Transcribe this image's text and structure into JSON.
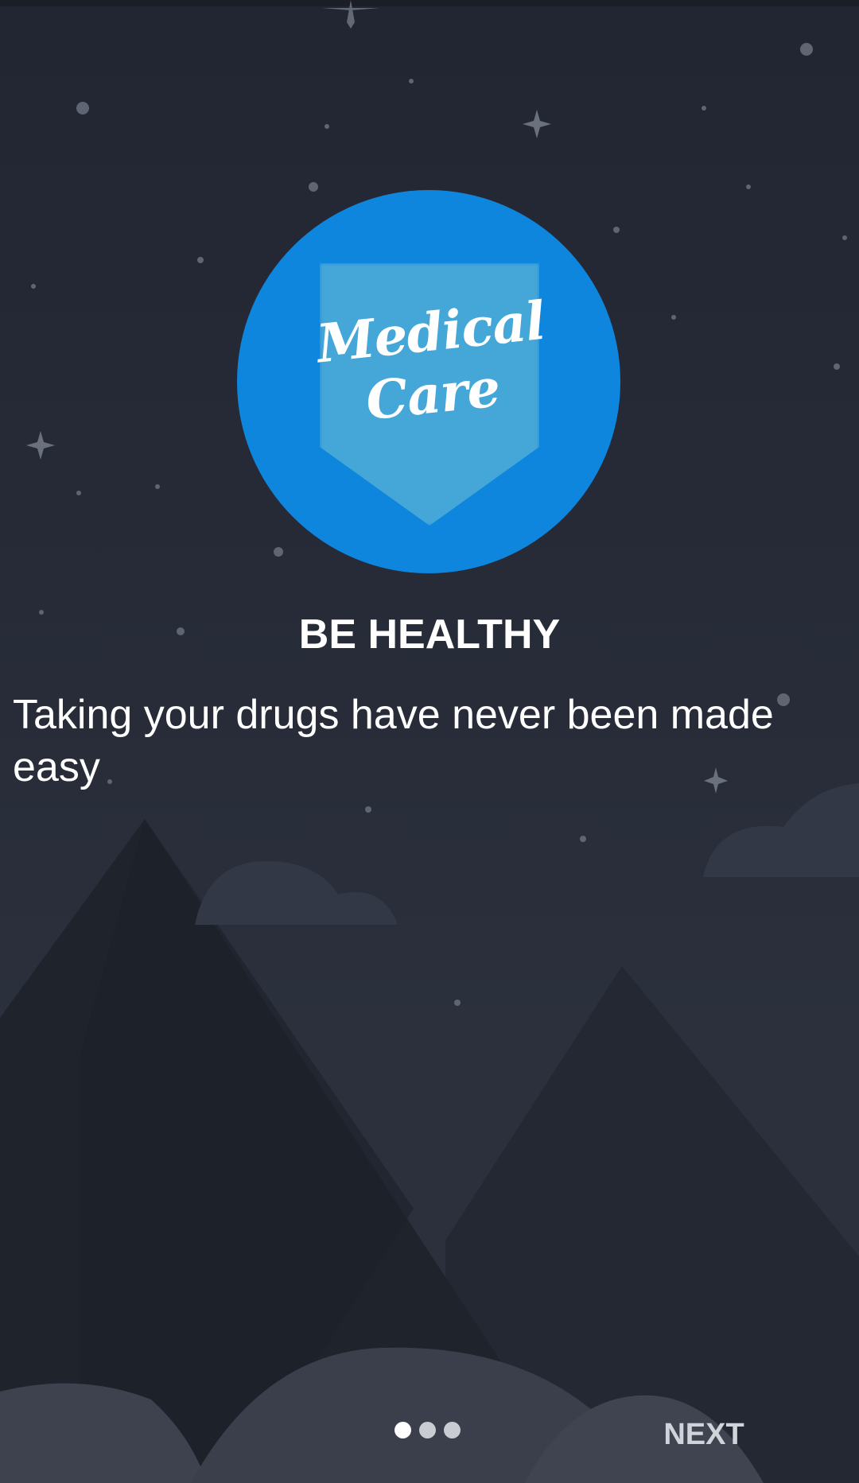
{
  "onboarding": {
    "logo": {
      "line1": "Medical",
      "line2": "Care",
      "circle_color": "#0f86de",
      "badge_color": "#45a6d8"
    },
    "title": "BE HEALTHY",
    "description": "Taking your drugs have never been made easy",
    "pager": {
      "total_pages": 3,
      "current_page": 1
    },
    "next_label": "NEXT"
  },
  "theme": {
    "background": "#222733",
    "mountain_dark": "#1f232d",
    "cloud": "#3a3f4b",
    "text": "#ffffff"
  }
}
